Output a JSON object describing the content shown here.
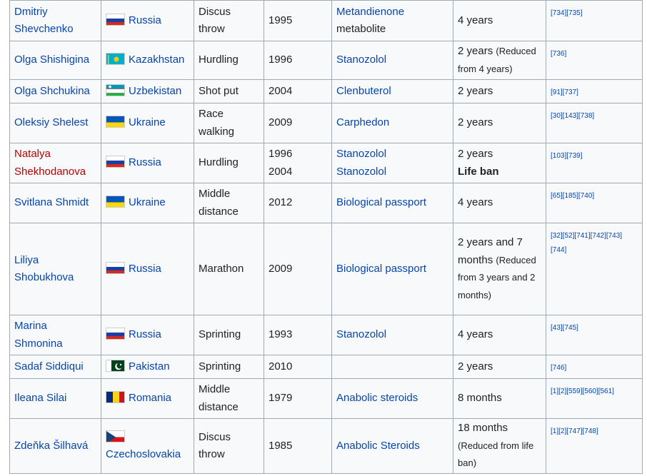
{
  "rows": [
    {
      "name": "Dmitriy Shevchenko",
      "name_red": false,
      "flag": "russia",
      "country": "Russia",
      "event": "Discus throw",
      "years": [
        "1995"
      ],
      "substances": [
        "Metandienone",
        "metabolite"
      ],
      "substance_link": [
        true,
        false
      ],
      "ban": [
        "4 years"
      ],
      "ban_note": "",
      "refs": "[734][735]"
    },
    {
      "name": "Olga Shishigina",
      "name_red": false,
      "flag": "kazakhstan",
      "country": "Kazakhstan",
      "event": "Hurdling",
      "years": [
        "1996"
      ],
      "substances": [
        "Stanozolol"
      ],
      "substance_link": [
        true
      ],
      "ban": [
        "2 years"
      ],
      "ban_note": "(Reduced from 4 years)",
      "refs": "[736]"
    },
    {
      "name": "Olga Shchukina",
      "name_red": false,
      "flag": "uzbekistan",
      "country": "Uzbekistan",
      "event": "Shot put",
      "years": [
        "2004"
      ],
      "substances": [
        "Clenbuterol"
      ],
      "substance_link": [
        true
      ],
      "ban": [
        "2 years"
      ],
      "ban_note": "",
      "refs": "[91][737]"
    },
    {
      "name": "Oleksiy Shelest",
      "name_red": false,
      "flag": "ukraine",
      "country": "Ukraine",
      "event": "Race walking",
      "years": [
        "2009"
      ],
      "substances": [
        "Carphedon"
      ],
      "substance_link": [
        true
      ],
      "ban": [
        "2 years"
      ],
      "ban_note": "",
      "refs": "[30][143][738]"
    },
    {
      "name": "Natalya Shekhodanova",
      "name_red": true,
      "flag": "russia",
      "country": "Russia",
      "event": "Hurdling",
      "years": [
        "1996",
        "2004"
      ],
      "substances": [
        "Stanozolol",
        "Stanozolol"
      ],
      "substance_link": [
        true,
        true
      ],
      "ban": [
        "2 years",
        "Life ban"
      ],
      "ban_note": "",
      "refs": "[103][739]"
    },
    {
      "name": "Svitlana Shmidt",
      "name_red": false,
      "flag": "ukraine",
      "country": "Ukraine",
      "event": "Middle distance",
      "years": [
        "2012"
      ],
      "substances": [
        "Biological passport"
      ],
      "substance_link": [
        true
      ],
      "ban": [
        "4 years"
      ],
      "ban_note": "",
      "refs": "[65][185][740]"
    },
    {
      "name": "Liliya Shobukhova",
      "name_red": false,
      "flag": "russia",
      "country": "Russia",
      "event": "Marathon",
      "years": [
        "2009"
      ],
      "substances": [
        "Biological passport"
      ],
      "substance_link": [
        true
      ],
      "ban": [
        "2 years and 7 months"
      ],
      "ban_note": "(Reduced from 3 years and 2 months)",
      "refs": "[32][52][741][742][743][744]"
    },
    {
      "name": "Marina Shmonina",
      "name_red": false,
      "flag": "russia",
      "country": "Russia",
      "event": "Sprinting",
      "years": [
        "1993"
      ],
      "substances": [
        "Stanozolol"
      ],
      "substance_link": [
        true
      ],
      "ban": [
        "4 years"
      ],
      "ban_note": "",
      "refs": "[43][745]"
    },
    {
      "name": "Sadaf Siddiqui",
      "name_red": false,
      "flag": "pakistan",
      "country": "Pakistan",
      "event": "Sprinting",
      "years": [
        "2010"
      ],
      "substances": [],
      "substance_link": [],
      "ban": [
        "2 years"
      ],
      "ban_note": "",
      "refs": "[746]"
    },
    {
      "name": "Ileana Silai",
      "name_red": false,
      "flag": "romania",
      "country": "Romania",
      "event": "Middle distance",
      "years": [
        "1979"
      ],
      "substances": [
        "Anabolic steroids"
      ],
      "substance_link": [
        true
      ],
      "ban": [
        "8 months"
      ],
      "ban_note": "",
      "refs": "[1][2][559][560][561]"
    },
    {
      "name": "Zdeňka Šilhavá",
      "name_red": false,
      "flag": "czechoslovakia",
      "country": "Czechoslovakia",
      "event": "Discus throw",
      "years": [
        "1985"
      ],
      "substances": [
        "Anabolic Steroids"
      ],
      "substance_link": [
        true
      ],
      "ban": [
        "18 months"
      ],
      "ban_note": "(Reduced from life ban)",
      "refs": "[1][2][747][748]"
    }
  ],
  "colors": {
    "link": "#0645ad",
    "redlink": "#ba0000",
    "border": "#a2a9b1",
    "cell_bg": "#f8f9fa"
  }
}
